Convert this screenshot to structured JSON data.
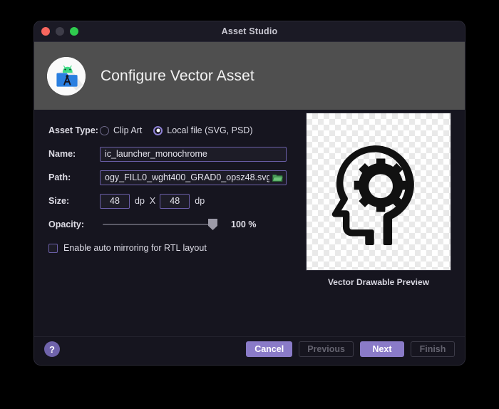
{
  "window": {
    "title": "Asset Studio",
    "traffic_lights": [
      "close-red",
      "minimize-yellow",
      "zoom-green"
    ]
  },
  "header": {
    "title": "Configure Vector Asset",
    "icon": "android-studio-asset-icon"
  },
  "form": {
    "asset_type": {
      "label": "Asset Type:",
      "options": [
        {
          "label": "Clip Art",
          "selected": false
        },
        {
          "label": "Local file (SVG, PSD)",
          "selected": true
        }
      ]
    },
    "name": {
      "label": "Name:",
      "value": "ic_launcher_monochrome",
      "placeholder": "Name"
    },
    "path": {
      "label": "Path:",
      "value": "ogy_FILL0_wght400_GRAD0_opsz48.svg",
      "placeholder": "Path",
      "browse_icon": "folder-icon"
    },
    "size": {
      "label": "Size:",
      "width": "48",
      "height": "48",
      "unit": "dp",
      "separator": "X"
    },
    "opacity": {
      "label": "Opacity:",
      "value": "100 %",
      "percent": 100
    },
    "mirror": {
      "label": "Enable auto mirroring for RTL layout",
      "checked": false
    }
  },
  "preview": {
    "caption": "Vector Drawable Preview",
    "drawable": "psychology-head-gear-icon"
  },
  "footer": {
    "help_label": "?",
    "buttons": [
      {
        "label": "Cancel",
        "style": "primary"
      },
      {
        "label": "Previous",
        "style": "disabled"
      },
      {
        "label": "Next",
        "style": "primary"
      },
      {
        "label": "Finish",
        "style": "disabled"
      }
    ]
  },
  "colors": {
    "accent_purple": "#8a7bc8",
    "field_border": "#6b5fa8",
    "dialog_bg": "#16151f",
    "header_bg": "#4f4f4f",
    "titlebar_bg": "#1b1a25"
  }
}
